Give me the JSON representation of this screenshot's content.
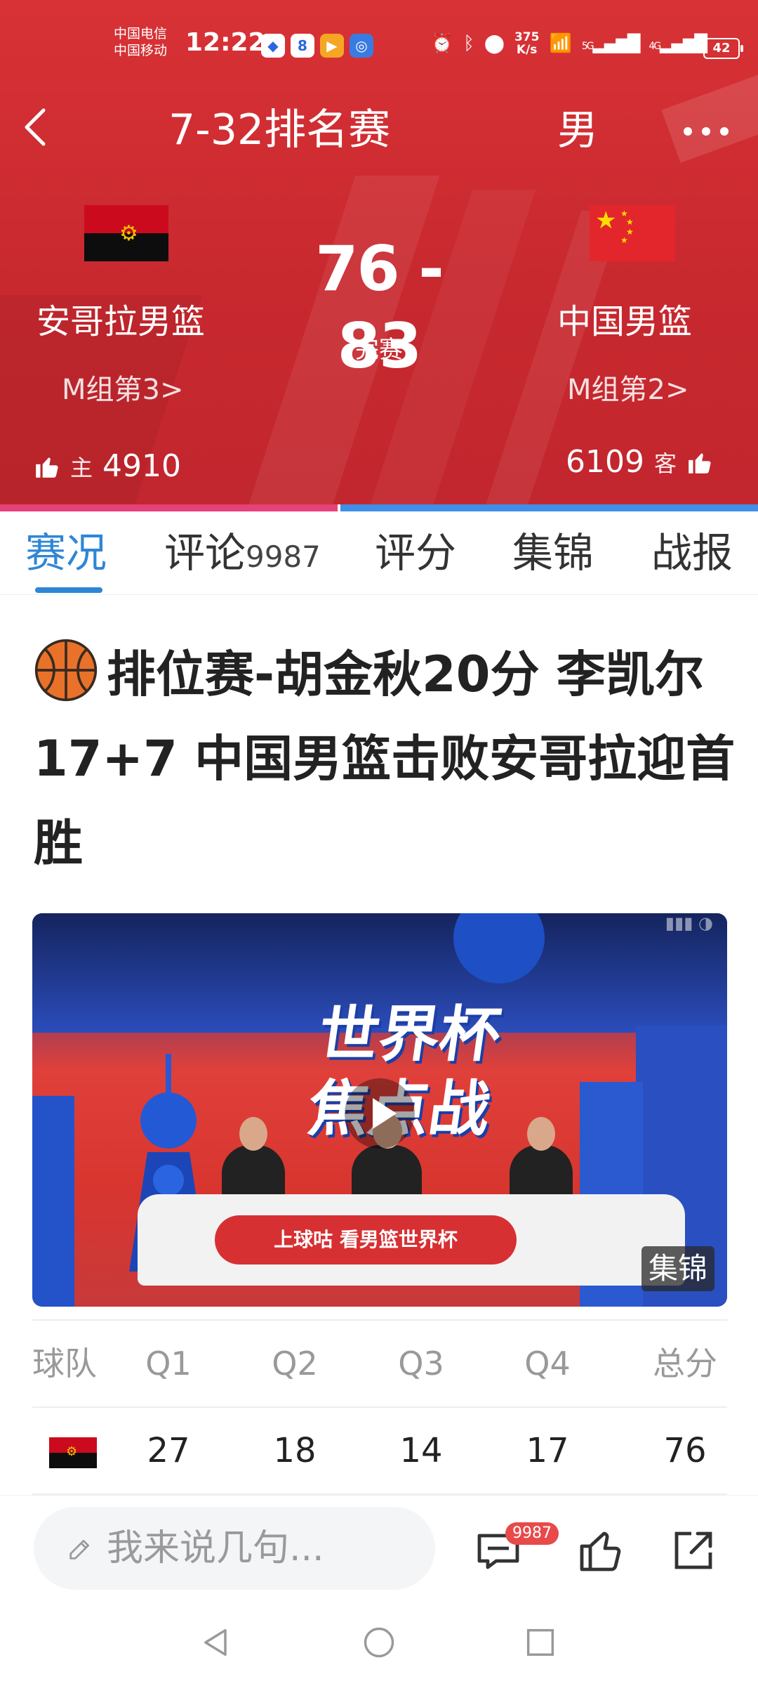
{
  "status_bar": {
    "carrier_1": "中国电信",
    "carrier_2": "中国移动",
    "time": "12:22",
    "net_speed_value": "375",
    "net_speed_unit": "K/s",
    "signal_1": "5G",
    "signal_2": "4G",
    "battery": "42"
  },
  "nav": {
    "title": "7-32排名赛",
    "gender": "男"
  },
  "match": {
    "home_team": "安哥拉男篮",
    "away_team": "中国男篮",
    "home_group": "M组第3>",
    "away_group": "M组第2>",
    "score": "76 - 83",
    "status": "完赛",
    "home_tag": "主",
    "away_tag": "客",
    "home_likes": "4910",
    "away_likes": "6109",
    "home_support_fraction": 0.445
  },
  "tabs": [
    {
      "label": "赛况",
      "count": ""
    },
    {
      "label": "评论",
      "count": "9987"
    },
    {
      "label": "评分",
      "count": ""
    },
    {
      "label": "集锦",
      "count": ""
    },
    {
      "label": "战报",
      "count": ""
    }
  ],
  "article": {
    "headline": "排位赛-胡金秋20分 李凯尔17+7 中国男篮击败安哥拉迎首胜",
    "video_title_1": "世界杯",
    "video_title_2": "焦点战",
    "video_banner": "上球咕 看男篮世界杯",
    "video_badge": "集锦"
  },
  "score_table": {
    "headers": [
      "球队",
      "Q1",
      "Q2",
      "Q3",
      "Q4",
      "总分"
    ],
    "rows": [
      {
        "team": "安哥拉",
        "q": [
          "27",
          "18",
          "14",
          "17"
        ],
        "total": "76"
      }
    ]
  },
  "bottom_bar": {
    "comment_placeholder": "我来说几句...",
    "comment_count_badge": "9987"
  },
  "colors": {
    "header_red": "#d83236",
    "accent_blue": "#2f86d6",
    "home_pink": "#e8407a",
    "away_blue": "#3f8fe8"
  }
}
